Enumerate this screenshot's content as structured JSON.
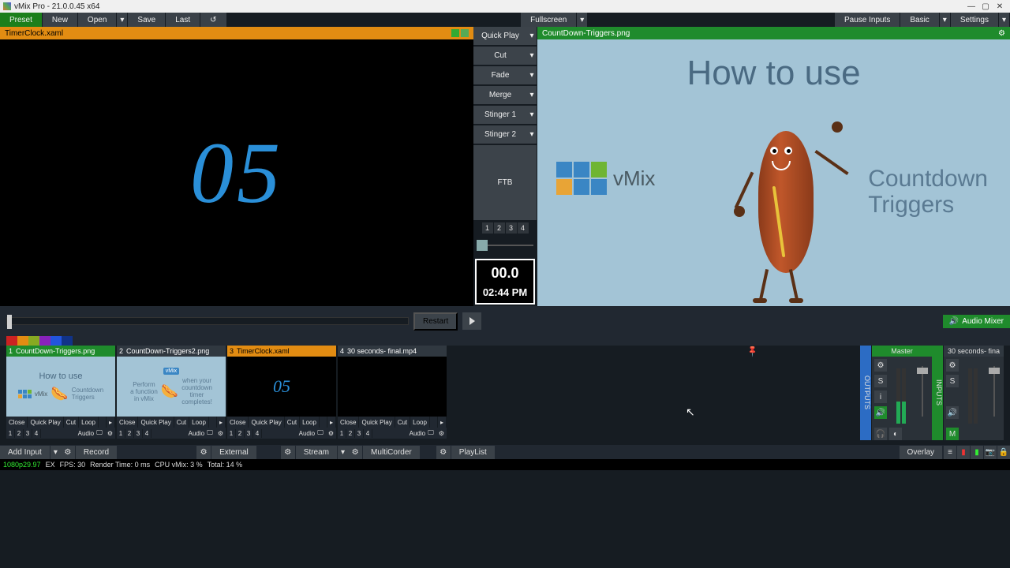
{
  "window": {
    "title": "vMix Pro - 21.0.0.45 x64"
  },
  "toolbar": {
    "preset": "Preset",
    "new": "New",
    "open": "Open",
    "save": "Save",
    "last": "Last",
    "fullscreen": "Fullscreen",
    "pauseInputs": "Pause Inputs",
    "basic": "Basic",
    "settings": "Settings"
  },
  "preview": {
    "title": "TimerClock.xaml",
    "display": "05"
  },
  "transitions": {
    "quickPlay": "Quick Play",
    "cut": "Cut",
    "fade": "Fade",
    "merge": "Merge",
    "stinger1": "Stinger 1",
    "stinger2": "Stinger 2",
    "ftb": "FTB",
    "nums": [
      "1",
      "2",
      "3",
      "4"
    ]
  },
  "clock": {
    "line1": "00.0",
    "line2": "02:44 PM"
  },
  "program": {
    "title": "CountDown-Triggers.png",
    "heading": "How to use",
    "logoText": "vMix",
    "rightLine1": "Countdown",
    "rightLine2": "Triggers"
  },
  "timeline": {
    "restart": "Restart"
  },
  "audioMixerTab": "Audio Mixer",
  "colors": [
    "#c22",
    "#e28c12",
    "#8a2",
    "#82b",
    "#25d",
    "#138"
  ],
  "inputs": [
    {
      "num": "1",
      "name": "CountDown-Triggers.png",
      "hStyle": "green",
      "thumb": "prog"
    },
    {
      "num": "2",
      "name": "CountDown-Triggers2.png",
      "hStyle": "dark",
      "thumb": "prog2"
    },
    {
      "num": "3",
      "name": "TimerClock.xaml",
      "hStyle": "orange",
      "thumb": "05"
    },
    {
      "num": "4",
      "name": "30 seconds- final.mp4",
      "hStyle": "dark",
      "thumb": "black"
    }
  ],
  "inputBtns": {
    "close": "Close",
    "quickPlay": "Quick Play",
    "cut": "Cut",
    "loop": "Loop",
    "audio": "Audio",
    "nums": [
      "1",
      "2",
      "3",
      "4"
    ]
  },
  "mixer": {
    "outputsTab": "OUTPUTS",
    "inputsTab": "INPUTS",
    "master": "Master",
    "ch2": "30 seconds- fina",
    "s": "S",
    "i": "i",
    "m": "M"
  },
  "bottom": {
    "addInput": "Add Input",
    "record": "Record",
    "external": "External",
    "stream": "Stream",
    "multicorder": "MultiCorder",
    "playlist": "PlayList",
    "overlay": "Overlay"
  },
  "status": {
    "res": "1080p29.97",
    "ex": "EX",
    "fps": "FPS: 30",
    "render": "Render Time: 0 ms",
    "cpu": "CPU vMix: 3 %",
    "total": "Total: 14 %"
  }
}
